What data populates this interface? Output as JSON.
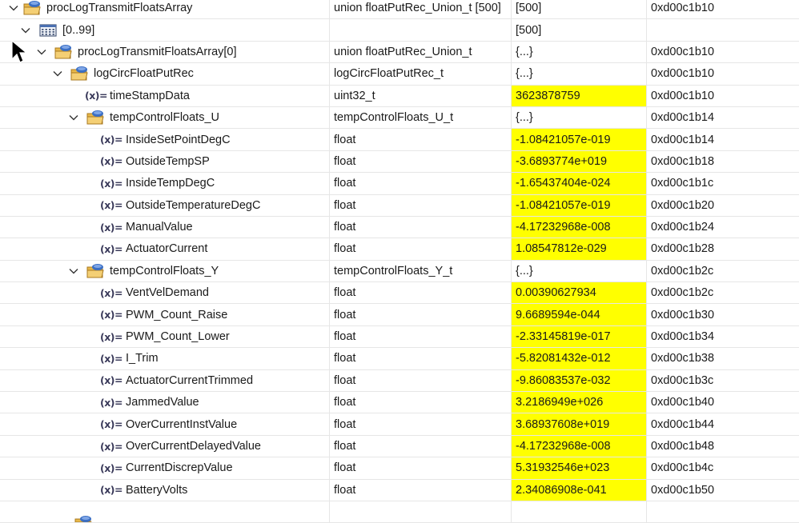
{
  "rows": [
    {
      "name": "procLogTransmitFloatsArray",
      "type": "union floatPutRec_Union_t [500]",
      "value": "[500]",
      "address": "0xd00c1b10",
      "kind": "struct",
      "expanded": true,
      "changed": false
    },
    {
      "name": "[0..99]",
      "type": "",
      "value": "[500]",
      "address": "",
      "kind": "array",
      "expanded": true,
      "changed": false
    },
    {
      "name": "procLogTransmitFloatsArray[0]",
      "type": "union floatPutRec_Union_t",
      "value": "{...}",
      "address": "0xd00c1b10",
      "kind": "struct",
      "expanded": true,
      "changed": false
    },
    {
      "name": "logCircFloatPutRec",
      "type": "logCircFloatPutRec_t",
      "value": "{...}",
      "address": "0xd00c1b10",
      "kind": "struct",
      "expanded": true,
      "changed": false
    },
    {
      "name": "timeStampData",
      "type": "uint32_t",
      "value": "3623878759",
      "address": "0xd00c1b10",
      "kind": "var",
      "changed": true
    },
    {
      "name": "tempControlFloats_U",
      "type": "tempControlFloats_U_t",
      "value": "{...}",
      "address": "0xd00c1b14",
      "kind": "struct",
      "expanded": true,
      "changed": false
    },
    {
      "name": "InsideSetPointDegC",
      "type": "float",
      "value": "-1.08421057e-019",
      "address": "0xd00c1b14",
      "kind": "var",
      "changed": true
    },
    {
      "name": "OutsideTempSP",
      "type": "float",
      "value": "-3.6893774e+019",
      "address": "0xd00c1b18",
      "kind": "var",
      "changed": true
    },
    {
      "name": "InsideTempDegC",
      "type": "float",
      "value": "-1.65437404e-024",
      "address": "0xd00c1b1c",
      "kind": "var",
      "changed": true
    },
    {
      "name": "OutsideTemperatureDegC",
      "type": "float",
      "value": "-1.08421057e-019",
      "address": "0xd00c1b20",
      "kind": "var",
      "changed": true
    },
    {
      "name": "ManualValue",
      "type": "float",
      "value": "-4.17232968e-008",
      "address": "0xd00c1b24",
      "kind": "var",
      "changed": true
    },
    {
      "name": "ActuatorCurrent",
      "type": "float",
      "value": "1.08547812e-029",
      "address": "0xd00c1b28",
      "kind": "var",
      "changed": true
    },
    {
      "name": "tempControlFloats_Y",
      "type": "tempControlFloats_Y_t",
      "value": "{...}",
      "address": "0xd00c1b2c",
      "kind": "struct",
      "expanded": true,
      "changed": false
    },
    {
      "name": "VentVelDemand",
      "type": "float",
      "value": "0.00390627934",
      "address": "0xd00c1b2c",
      "kind": "var",
      "changed": true
    },
    {
      "name": "PWM_Count_Raise",
      "type": "float",
      "value": "9.6689594e-044",
      "address": "0xd00c1b30",
      "kind": "var",
      "changed": true
    },
    {
      "name": "PWM_Count_Lower",
      "type": "float",
      "value": "-2.33145819e-017",
      "address": "0xd00c1b34",
      "kind": "var",
      "changed": true
    },
    {
      "name": "I_Trim",
      "type": "float",
      "value": "-5.82081432e-012",
      "address": "0xd00c1b38",
      "kind": "var",
      "changed": true
    },
    {
      "name": "ActuatorCurrentTrimmed",
      "type": "float",
      "value": "-9.86083537e-032",
      "address": "0xd00c1b3c",
      "kind": "var",
      "changed": true
    },
    {
      "name": "JammedValue",
      "type": "float",
      "value": "3.2186949e+026",
      "address": "0xd00c1b40",
      "kind": "var",
      "changed": true
    },
    {
      "name": "OverCurrentInstValue",
      "type": "float",
      "value": "3.68937608e+019",
      "address": "0xd00c1b44",
      "kind": "var",
      "changed": true
    },
    {
      "name": "OverCurrentDelayedValue",
      "type": "float",
      "value": "-4.17232968e-008",
      "address": "0xd00c1b48",
      "kind": "var",
      "changed": true
    },
    {
      "name": "CurrentDiscrepValue",
      "type": "float",
      "value": "5.31932546e+023",
      "address": "0xd00c1b4c",
      "kind": "var",
      "changed": true
    },
    {
      "name": "BatteryVolts",
      "type": "float",
      "value": "2.34086908e-041",
      "address": "0xd00c1b50",
      "kind": "var",
      "changed": true
    },
    {
      "name": "",
      "type": "",
      "value": "",
      "address": "",
      "kind": "struct-partial",
      "changed": false
    }
  ],
  "icons": {
    "struct": "struct-folder-icon",
    "array": "array-range-icon",
    "var": "variable-icon",
    "twisty": "chevron-down-icon"
  },
  "colors": {
    "changed_highlight": "#ffff00",
    "grid_line": "#e6e6e6",
    "folder": "#e8b84a",
    "struct_ball": "#3b6fc4"
  },
  "var_icon_glyph": "(x)="
}
